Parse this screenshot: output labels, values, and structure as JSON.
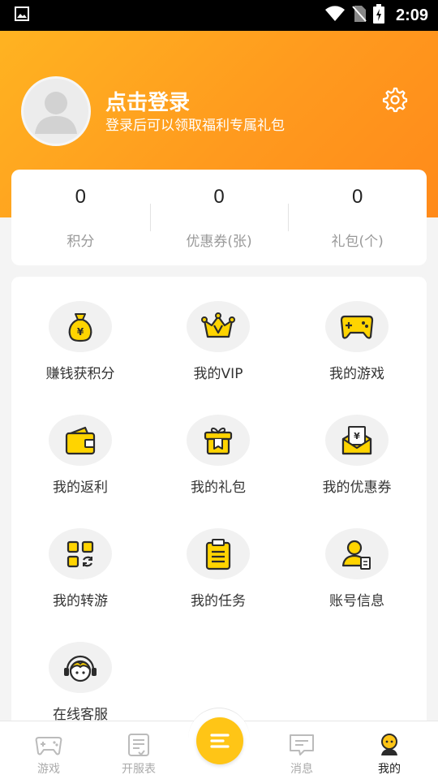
{
  "status_bar": {
    "time": "2:09",
    "icons": [
      "image-icon",
      "wifi-icon",
      "no-sim-icon",
      "battery-charging-icon"
    ]
  },
  "header": {
    "title": "点击登录",
    "subtitle": "登录后可以领取福利专属礼包",
    "settings_icon": "gear-icon",
    "avatar_icon": "default-avatar-icon"
  },
  "stats": [
    {
      "value": "0",
      "label": "积分"
    },
    {
      "value": "0",
      "label": "优惠券(张)"
    },
    {
      "value": "0",
      "label": "礼包(个)"
    }
  ],
  "menu": [
    {
      "label": "赚钱获积分",
      "icon": "money-bag-icon"
    },
    {
      "label": "我的VIP",
      "icon": "crown-icon"
    },
    {
      "label": "我的游戏",
      "icon": "gamepad-icon"
    },
    {
      "label": "我的返利",
      "icon": "wallet-icon"
    },
    {
      "label": "我的礼包",
      "icon": "gift-icon"
    },
    {
      "label": "我的优惠券",
      "icon": "coupon-envelope-icon"
    },
    {
      "label": "我的转游",
      "icon": "transfer-grid-icon"
    },
    {
      "label": "我的任务",
      "icon": "clipboard-icon"
    },
    {
      "label": "账号信息",
      "icon": "account-info-icon"
    },
    {
      "label": "在线客服",
      "icon": "customer-service-icon"
    }
  ],
  "bottom_nav": [
    {
      "label": "游戏",
      "icon": "game-controller-icon",
      "active": false
    },
    {
      "label": "开服表",
      "icon": "server-list-icon",
      "active": false
    },
    {
      "label": "",
      "icon": "menu-lines-icon",
      "active": false
    },
    {
      "label": "消息",
      "icon": "message-icon",
      "active": false
    },
    {
      "label": "我的",
      "icon": "profile-icon",
      "active": true
    }
  ],
  "colors": {
    "accent": "#ffc516",
    "header_gradient_start": "#ffb321",
    "header_gradient_end": "#ff8a1a",
    "icon_dark": "#2b2b2b"
  }
}
